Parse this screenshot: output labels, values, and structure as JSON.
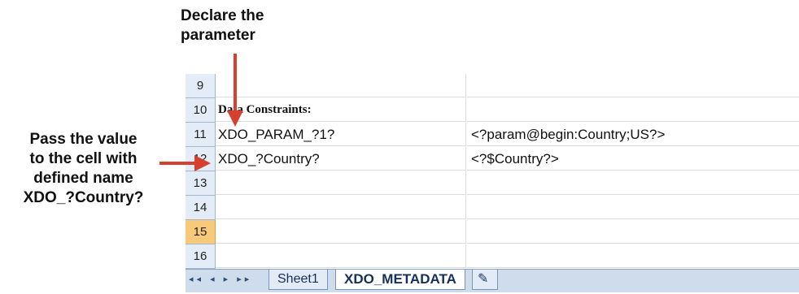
{
  "callouts": {
    "top_line1": "Declare the",
    "top_line2": "parameter",
    "left_line1": "Pass the value",
    "left_line2": "to the cell with",
    "left_line3": "defined name",
    "left_line4": "XDO_?Country?"
  },
  "rows": [
    {
      "num": "9",
      "a": "",
      "b": ""
    },
    {
      "num": "10",
      "a": "Data Constraints:",
      "b": ""
    },
    {
      "num": "11",
      "a": "XDO_PARAM_?1?",
      "b": "<?param@begin:Country;US?>"
    },
    {
      "num": "12",
      "a": "XDO_?Country?",
      "b": "<?$Country?>"
    },
    {
      "num": "13",
      "a": "",
      "b": ""
    },
    {
      "num": "14",
      "a": "",
      "b": ""
    },
    {
      "num": "15",
      "a": "",
      "b": ""
    },
    {
      "num": "16",
      "a": "",
      "b": ""
    }
  ],
  "tabs": {
    "nav": "◂◂ ◂ ▸ ▸▸",
    "sheet1": "Sheet1",
    "meta": "XDO_METADATA",
    "insert": "✎"
  },
  "colors": {
    "arrow": "#d6402e",
    "selected_row": "#f8c97a"
  }
}
